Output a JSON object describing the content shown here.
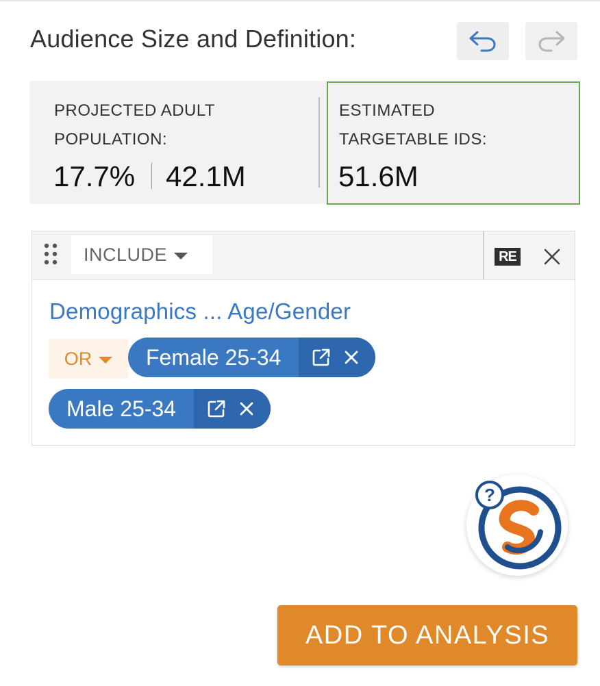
{
  "header": {
    "title": "Audience Size and Definition:",
    "undo_icon": "undo-icon",
    "redo_icon": "redo-icon"
  },
  "stats": {
    "projected": {
      "label_line1": "PROJECTED ADULT",
      "label_line2": "POPULATION:",
      "percent": "17.7%",
      "count": "42.1M"
    },
    "estimated": {
      "label_line1": "ESTIMATED",
      "label_line2": "TARGETABLE IDS:",
      "value": "51.6M"
    }
  },
  "criteria": {
    "include_label": "INCLUDE",
    "re_badge": "RE",
    "section_title": "Demographics ... Age/Gender",
    "operator_label": "OR",
    "pills": [
      {
        "label": "Female 25-34"
      },
      {
        "label": "Male 25-34"
      }
    ]
  },
  "actions": {
    "add_label": "ADD TO ANALYSIS"
  },
  "colors": {
    "accent_orange": "#e0892a",
    "accent_blue": "#3b78c2",
    "highlight_green": "#6aa84f"
  }
}
